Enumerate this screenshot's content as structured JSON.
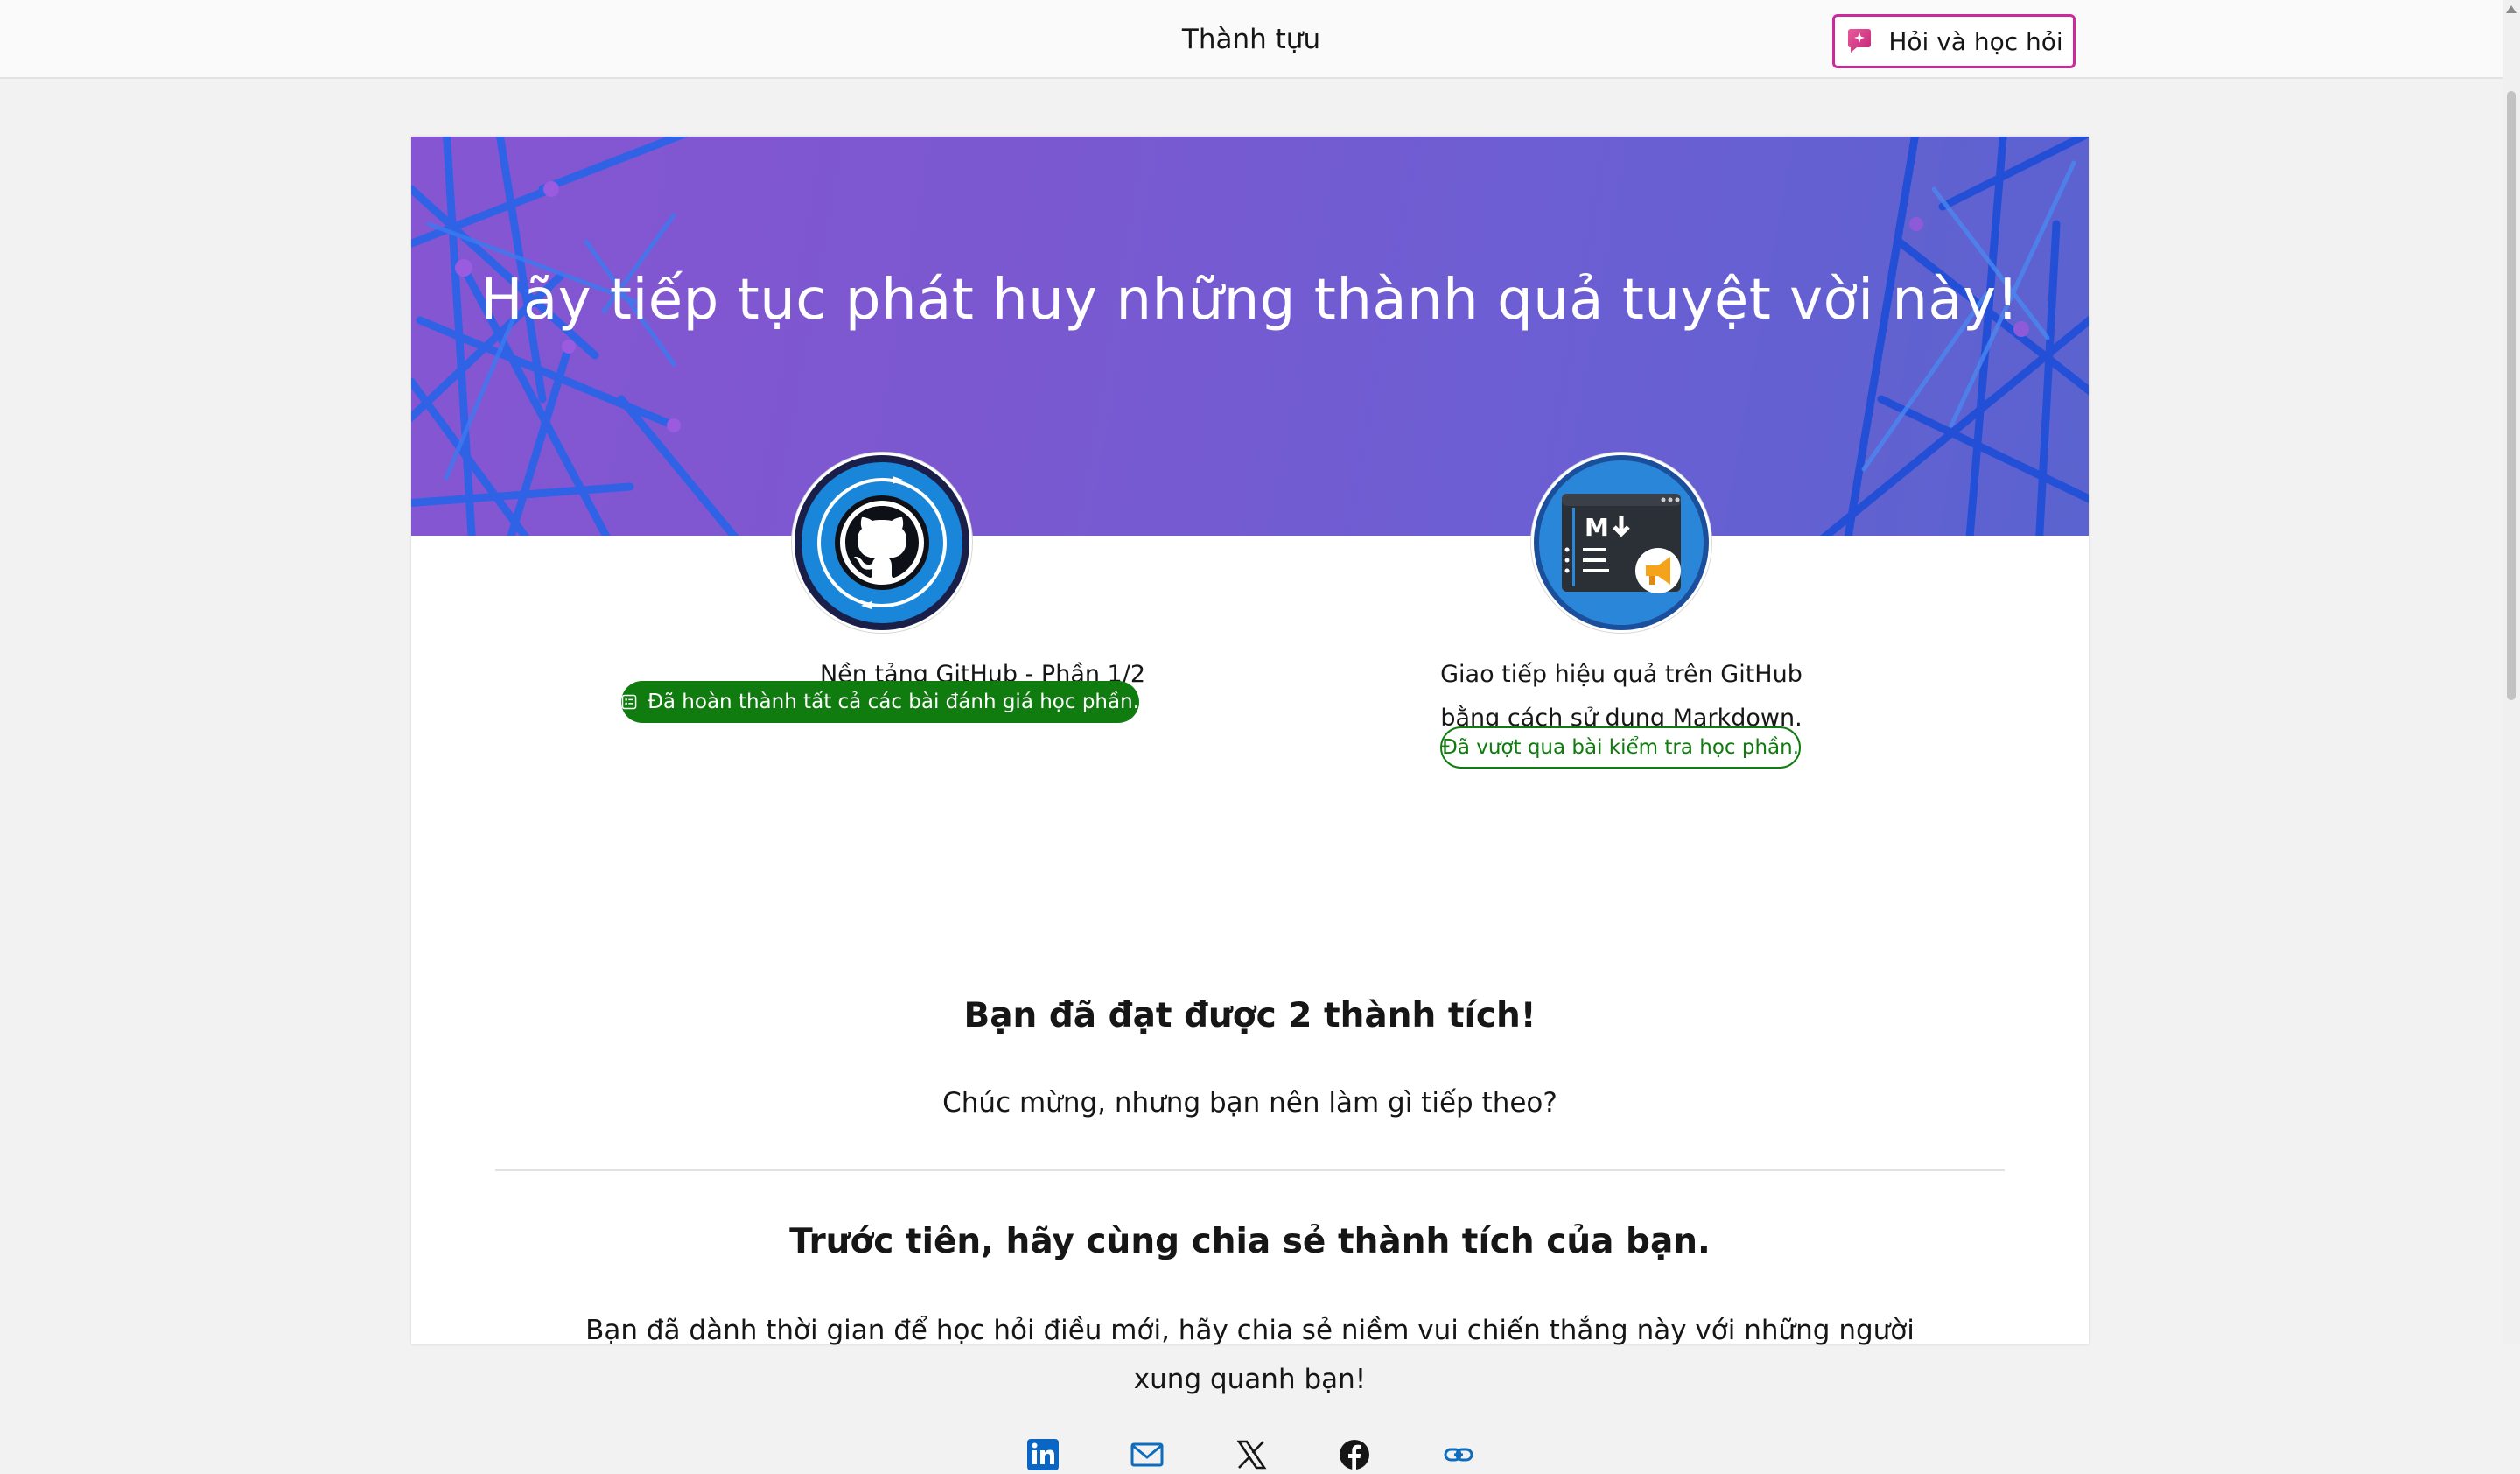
{
  "header": {
    "title": "Thành tựu",
    "ask_button_label": "Hỏi và học hỏi"
  },
  "hero": {
    "title": "Hãy tiếp tục phát huy những thành quả tuyệt vời này!"
  },
  "achievements": [
    {
      "title": "Nền tảng GitHub - Phần 1/2",
      "status": "Đã hoàn thành tất cả các bài đánh giá học phần.",
      "status_style": "solid",
      "icon": "github-badge-icon"
    },
    {
      "title_line1": "Giao tiếp hiệu quả trên GitHub",
      "title_line2": "bằng cách sử dụng Markdown.",
      "status": "Đã vượt qua bài kiểm tra học phần.",
      "status_style": "outline",
      "icon": "markdown-badge-icon"
    }
  ],
  "summary": {
    "count_heading": "Bạn đã đạt được 2 thành tích!",
    "congrats": "Chúc mừng, nhưng bạn nên làm gì tiếp theo?"
  },
  "share": {
    "heading": "Trước tiên, hãy cùng chia sẻ thành tích của bạn.",
    "description": "Bạn đã dành thời gian để học hỏi điều mới, hãy chia sẻ niềm vui chiến thắng này với những người xung quanh bạn!",
    "icons": [
      "linkedin-icon",
      "email-icon",
      "x-twitter-icon",
      "facebook-icon",
      "link-icon"
    ]
  },
  "colors": {
    "success_green": "#107c10",
    "ask_border": "#cc2a9c",
    "hero_gradient_start": "#8656d2",
    "hero_gradient_end": "#5a63cf",
    "badge_blue": "#1e7fd6"
  }
}
